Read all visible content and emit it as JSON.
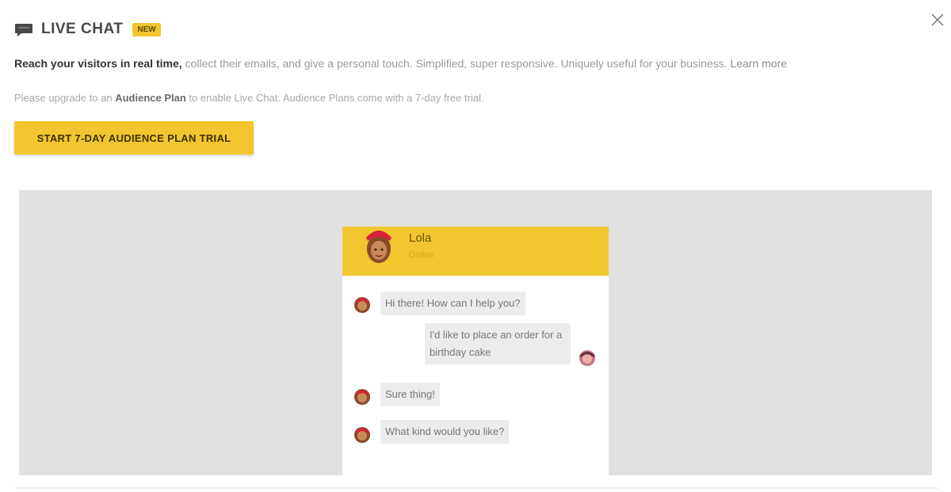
{
  "header": {
    "title": "LIVE CHAT",
    "badge": "NEW",
    "icon": "chat-icon"
  },
  "description": {
    "bold": "Reach your visitors in real time,",
    "rest": " collect their emails, and give a personal touch. Simplified, super responsive. Uniquely useful for your business.",
    "learn_more": "Learn more"
  },
  "note": {
    "prefix": "Please upgrade to an ",
    "plan": "Audience Plan",
    "suffix": " to enable Live Chat. Audience Plans come with a 7-day free trial."
  },
  "cta": {
    "label": "START 7-DAY AUDIENCE PLAN TRIAL"
  },
  "close": {
    "icon": "close-icon"
  },
  "widget": {
    "agent_name": "Lola",
    "agent_status": "Online",
    "messages": [
      {
        "from": "agent",
        "text": "Hi there! How can I help you?"
      },
      {
        "from": "visitor",
        "text": "I'd like to place an order for a birthday cake"
      },
      {
        "from": "agent",
        "text": "Sure thing!"
      },
      {
        "from": "agent",
        "text": "What kind would you like?"
      }
    ]
  },
  "colors": {
    "accent": "#f2c62f",
    "preview_bg": "#e1e1e1",
    "bubble_bg": "#ececec"
  }
}
